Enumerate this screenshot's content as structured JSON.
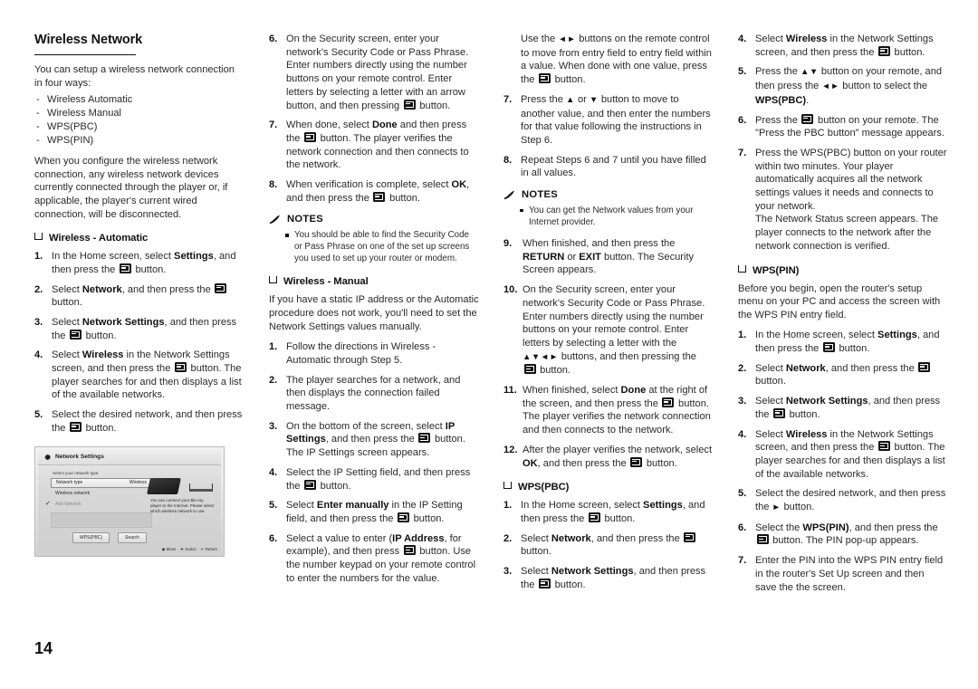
{
  "page": {
    "number": "14",
    "section_title": "Wireless Network"
  },
  "col1": {
    "intro": "You can setup a wireless network connection in four ways:",
    "methods": [
      "Wireless Automatic",
      "Wireless Manual",
      "WPS(PBC)",
      "WPS(PIN)"
    ],
    "warning": "When you configure the wireless network connection, any wireless network devices currently connected through the player or, if applicable, the player's current wired connection, will be disconnected.",
    "subheading": "Wireless - Automatic",
    "steps": [
      {
        "num": "1.",
        "parts": [
          {
            "t": "In the Home screen, select "
          },
          {
            "b": "Settings"
          },
          {
            "t": ", and then press the "
          },
          {
            "icon": "enter-button"
          },
          {
            "t": " button."
          }
        ]
      },
      {
        "num": "2.",
        "parts": [
          {
            "t": "Select "
          },
          {
            "b": "Network"
          },
          {
            "t": ", and then press the "
          },
          {
            "icon": "enter-button"
          },
          {
            "t": " button."
          }
        ]
      },
      {
        "num": "3.",
        "parts": [
          {
            "t": "Select "
          },
          {
            "b": "Network Settings"
          },
          {
            "t": ", and then press the "
          },
          {
            "icon": "enter-button"
          },
          {
            "t": " button."
          }
        ]
      },
      {
        "num": "4.",
        "parts": [
          {
            "t": "Select "
          },
          {
            "b": "Wireless"
          },
          {
            "t": " in the Network Settings screen, and then press the "
          },
          {
            "icon": "enter-button"
          },
          {
            "t": " button. The player searches for and then displays a list of the available networks."
          }
        ]
      },
      {
        "num": "5.",
        "parts": [
          {
            "t": "Select the desired network, and then press the "
          },
          {
            "icon": "enter-button"
          },
          {
            "t": " button."
          }
        ]
      }
    ],
    "figure": {
      "title": "Network Settings",
      "gear_icon": "gear-icon",
      "hint": "Select your network type.",
      "row_label": "Network type",
      "row_value": "Wireless",
      "row2": "Wireless network",
      "row3": "Add Network",
      "description": "You can connect your Blu-ray player to the Internet. Please select which wireless network to use.",
      "buttons": [
        "WPS(PBC)",
        "Search"
      ],
      "status": [
        {
          "icon": "dpad-icon",
          "label": "Move"
        },
        {
          "icon": "enter-icon",
          "label": "Select"
        },
        {
          "icon": "return-icon",
          "label": "Return"
        }
      ]
    }
  },
  "col2": {
    "steps_top": [
      {
        "num": "6.",
        "parts": [
          {
            "t": "On the Security screen, enter your network's Security Code or Pass Phrase. Enter numbers directly using the number buttons on your remote control. Enter letters by selecting a letter with an arrow button, and then pressing "
          },
          {
            "icon": "enter-button"
          },
          {
            "t": " button."
          }
        ]
      },
      {
        "num": "7.",
        "parts": [
          {
            "t": "When done, select "
          },
          {
            "b": "Done"
          },
          {
            "t": " and then press the "
          },
          {
            "icon": "enter-button"
          },
          {
            "t": " button. The player verifies the network connection and then connects to the network."
          }
        ]
      },
      {
        "num": "8.",
        "parts": [
          {
            "t": "When verification is complete, select "
          },
          {
            "b": "OK"
          },
          {
            "t": ", and then press the "
          },
          {
            "icon": "enter-button"
          },
          {
            "t": " button."
          }
        ]
      }
    ],
    "notes_label": "NOTES",
    "notes": [
      "You should be able to find the Security Code or Pass Phrase on one of the set up screens you used to set up your router or modem."
    ],
    "subheading": "Wireless - Manual",
    "intro": "If you have a static IP address or the Automatic procedure does not work, you'll need to set the Network Settings values manually.",
    "steps": [
      {
        "num": "1.",
        "parts": [
          {
            "t": "Follow the directions in Wireless - Automatic through Step 5."
          }
        ]
      },
      {
        "num": "2.",
        "parts": [
          {
            "t": "The player searches for a network, and then displays the connection failed message."
          }
        ]
      },
      {
        "num": "3.",
        "parts": [
          {
            "t": "On the bottom of the screen, select "
          },
          {
            "b": "IP Settings"
          },
          {
            "t": ", and then press the "
          },
          {
            "icon": "enter-button"
          },
          {
            "t": " button. The IP Settings screen appears."
          }
        ]
      },
      {
        "num": "4.",
        "parts": [
          {
            "t": "Select the IP Setting field, and then press the "
          },
          {
            "icon": "enter-button"
          },
          {
            "t": " button."
          }
        ]
      },
      {
        "num": "5.",
        "parts": [
          {
            "t": "Select "
          },
          {
            "b": "Enter manually"
          },
          {
            "t": " in the IP Setting field, and then press the "
          },
          {
            "icon": "enter-button"
          },
          {
            "t": " button."
          }
        ]
      },
      {
        "num": "6.",
        "parts": [
          {
            "t": "Select a value to enter ("
          },
          {
            "b": "IP Address"
          },
          {
            "t": ", for example), and then press "
          },
          {
            "icon": "enter-button"
          },
          {
            "t": " button. Use the number keypad on your remote control to enter the numbers for the value."
          }
        ]
      }
    ]
  },
  "col3": {
    "continuation": [
      {
        "t": "Use the "
      },
      {
        "icon": "left-right-arrows"
      },
      {
        "t": " buttons on the remote control to move from entry field to entry field within a value. When done with one value, press the "
      },
      {
        "icon": "enter-button"
      },
      {
        "t": " button."
      }
    ],
    "steps_top": [
      {
        "num": "7.",
        "parts": [
          {
            "t": "Press the "
          },
          {
            "icon": "up-arrow"
          },
          {
            "t": " or "
          },
          {
            "icon": "down-arrow"
          },
          {
            "t": " button to move to another value, and then enter the numbers for that value following the instructions in Step 6."
          }
        ]
      },
      {
        "num": "8.",
        "parts": [
          {
            "t": "Repeat Steps 6 and 7 until you have filled in all values."
          }
        ]
      }
    ],
    "notes_label": "NOTES",
    "notes": [
      "You can get the Network values from your Internet provider."
    ],
    "steps_bottom": [
      {
        "num": "9.",
        "parts": [
          {
            "t": "When finished, and then press the "
          },
          {
            "b": "RETURN"
          },
          {
            "t": " or "
          },
          {
            "b": "EXIT"
          },
          {
            "t": " button. The Security Screen appears."
          }
        ]
      },
      {
        "num": "10.",
        "parts": [
          {
            "t": "On the Security screen, enter your network's Security Code or Pass Phrase. Enter numbers directly using the number buttons on your remote control. Enter letters by selecting a letter with the "
          },
          {
            "icon": "four-arrows"
          },
          {
            "t": " buttons, and then pressing the "
          },
          {
            "icon": "enter-button"
          },
          {
            "t": " button."
          }
        ]
      },
      {
        "num": "11.",
        "parts": [
          {
            "t": "When finished, select "
          },
          {
            "b": "Done"
          },
          {
            "t": " at the right of the screen, and then press the "
          },
          {
            "icon": "enter-button"
          },
          {
            "t": " button."
          }
        ],
        "extra": "The player verifies the network connection and then connects to the network."
      },
      {
        "num": "12.",
        "parts": [
          {
            "t": "After the player verifies the network, select "
          },
          {
            "b": "OK"
          },
          {
            "t": ", and then press the "
          },
          {
            "icon": "enter-button"
          },
          {
            "t": " button."
          }
        ]
      }
    ],
    "subheading": "WPS(PBC)",
    "wps_steps": [
      {
        "num": "1.",
        "parts": [
          {
            "t": "In the Home screen, select "
          },
          {
            "b": "Settings"
          },
          {
            "t": ", and then press the "
          },
          {
            "icon": "enter-button"
          },
          {
            "t": " button."
          }
        ]
      },
      {
        "num": "2.",
        "parts": [
          {
            "t": "Select "
          },
          {
            "b": "Network"
          },
          {
            "t": ", and then press the "
          },
          {
            "icon": "enter-button"
          },
          {
            "t": " button."
          }
        ]
      },
      {
        "num": "3.",
        "parts": [
          {
            "t": "Select "
          },
          {
            "b": "Network Settings"
          },
          {
            "t": ", and then press the "
          },
          {
            "icon": "enter-button"
          },
          {
            "t": " button."
          }
        ]
      }
    ]
  },
  "col4": {
    "steps_top": [
      {
        "num": "4.",
        "parts": [
          {
            "t": "Select "
          },
          {
            "b": "Wireless"
          },
          {
            "t": " in the Network Settings screen, and then press the "
          },
          {
            "icon": "enter-button"
          },
          {
            "t": " button."
          }
        ]
      },
      {
        "num": "5.",
        "parts": [
          {
            "t": "Press the "
          },
          {
            "icon": "up-down-arrows"
          },
          {
            "t": " button on your remote, and then press the "
          },
          {
            "icon": "left-right-arrows"
          },
          {
            "t": " button to select the "
          },
          {
            "b": "WPS(PBC)"
          },
          {
            "t": "."
          }
        ]
      },
      {
        "num": "6.",
        "parts": [
          {
            "t": "Press the "
          },
          {
            "icon": "enter-button"
          },
          {
            "t": " button on your remote. The \"Press the PBC button\" message appears."
          }
        ]
      },
      {
        "num": "7.",
        "parts": [
          {
            "t": "Press the WPS(PBC) button on your router within two minutes. Your player automatically acquires all the network settings values it needs and connects to your network."
          }
        ],
        "extra": "The Network Status screen appears. The player connects to the network after the network connection is verified."
      }
    ],
    "subheading": "WPS(PIN)",
    "intro": "Before you begin, open the router's setup menu on your PC and access the screen with the WPS PIN entry field.",
    "steps": [
      {
        "num": "1.",
        "parts": [
          {
            "t": "In the Home screen, select "
          },
          {
            "b": "Settings"
          },
          {
            "t": ", and then press the "
          },
          {
            "icon": "enter-button"
          },
          {
            "t": " button."
          }
        ]
      },
      {
        "num": "2.",
        "parts": [
          {
            "t": "Select "
          },
          {
            "b": "Network"
          },
          {
            "t": ", and then press the "
          },
          {
            "icon": "enter-button"
          },
          {
            "t": " button."
          }
        ]
      },
      {
        "num": "3.",
        "parts": [
          {
            "t": "Select "
          },
          {
            "b": "Network Settings"
          },
          {
            "t": ", and then press the "
          },
          {
            "icon": "enter-button"
          },
          {
            "t": " button."
          }
        ]
      },
      {
        "num": "4.",
        "parts": [
          {
            "t": "Select "
          },
          {
            "b": "Wireless"
          },
          {
            "t": " in the Network Settings screen, and then press the "
          },
          {
            "icon": "enter-button"
          },
          {
            "t": " button. The player searches for and then displays a list of the available networks."
          }
        ]
      },
      {
        "num": "5.",
        "parts": [
          {
            "t": "Select the desired network, and then press the "
          },
          {
            "icon": "right-arrow"
          },
          {
            "t": " button."
          }
        ]
      },
      {
        "num": "6.",
        "parts": [
          {
            "t": "Select the "
          },
          {
            "b": "WPS(PIN)"
          },
          {
            "t": ", and then press the "
          },
          {
            "icon": "enter-button"
          },
          {
            "t": " button. The PIN pop-up appears."
          }
        ]
      },
      {
        "num": "7.",
        "parts": [
          {
            "t": "Enter the PIN into the WPS PIN entry field in the router's Set Up screen and then save the the screen."
          }
        ]
      }
    ]
  }
}
